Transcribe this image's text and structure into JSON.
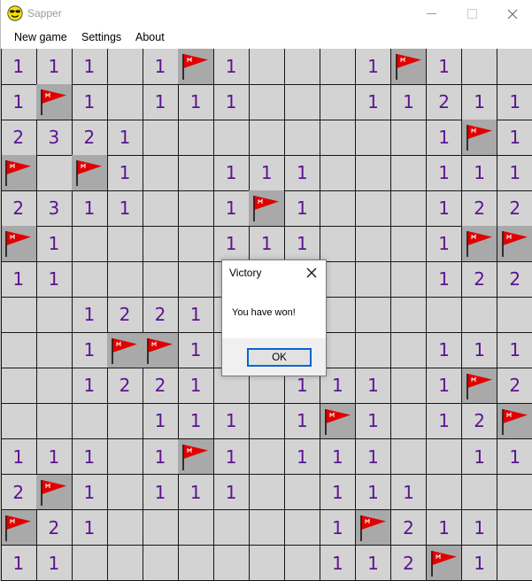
{
  "window": {
    "title": "Sapper",
    "app_icon": "sunglasses-smiley-icon"
  },
  "menu": {
    "items": [
      "New game",
      "Settings",
      "About"
    ]
  },
  "board": {
    "rows": 15,
    "cols": 15,
    "grid": [
      [
        "1",
        "1",
        "1",
        "",
        "1",
        "F",
        "1",
        "",
        "",
        "",
        "1",
        "F",
        "1",
        "",
        ""
      ],
      [
        "1",
        "F",
        "1",
        "",
        "1",
        "1",
        "1",
        "",
        "",
        "",
        "1",
        "1",
        "2",
        "1",
        "1"
      ],
      [
        "2",
        "3",
        "2",
        "1",
        "",
        "",
        "",
        "",
        "",
        "",
        "",
        "",
        "1",
        "F",
        "1"
      ],
      [
        "F",
        "",
        "F",
        "1",
        "",
        "",
        "1",
        "1",
        "1",
        "",
        "",
        "",
        "1",
        "1",
        "1"
      ],
      [
        "2",
        "3",
        "1",
        "1",
        "",
        "",
        "1",
        "F",
        "1",
        "",
        "",
        "",
        "1",
        "2",
        "2"
      ],
      [
        "F",
        "1",
        "",
        "",
        "",
        "",
        "1",
        "1",
        "1",
        "",
        "",
        "",
        "1",
        "F",
        "F"
      ],
      [
        "1",
        "1",
        "",
        "",
        "",
        "",
        "",
        "",
        "",
        "",
        "",
        "",
        "1",
        "2",
        "2"
      ],
      [
        "",
        "",
        "1",
        "2",
        "2",
        "1",
        "",
        "",
        "",
        "",
        "",
        "",
        "",
        "",
        ""
      ],
      [
        "",
        "",
        "1",
        "F",
        "F",
        "1",
        "",
        "",
        "",
        "",
        "",
        "",
        "1",
        "1",
        "1"
      ],
      [
        "",
        "",
        "1",
        "2",
        "2",
        "1",
        "",
        "",
        "1",
        "1",
        "1",
        "",
        "1",
        "F",
        "2"
      ],
      [
        "",
        "",
        "",
        "",
        "1",
        "1",
        "1",
        "",
        "1",
        "F",
        "1",
        "",
        "1",
        "2",
        "F"
      ],
      [
        "1",
        "1",
        "1",
        "",
        "1",
        "F",
        "1",
        "",
        "1",
        "1",
        "1",
        "",
        "",
        "1",
        "1"
      ],
      [
        "2",
        "F",
        "1",
        "",
        "1",
        "1",
        "1",
        "",
        "",
        "1",
        "1",
        "1",
        "",
        "",
        ""
      ],
      [
        "F",
        "2",
        "1",
        "",
        "",
        "",
        "",
        "",
        "",
        "1",
        "F",
        "2",
        "1",
        "1",
        ""
      ],
      [
        "1",
        "1",
        "",
        "",
        "",
        "",
        "",
        "",
        "",
        "1",
        "1",
        "2",
        "F",
        "1",
        ""
      ]
    ]
  },
  "dialog": {
    "title": "Victory",
    "message": "You have won!",
    "ok_label": "OK"
  },
  "colors": {
    "number": "#5c1391",
    "flag": "#e00000",
    "open_cell": "#d3d3d3",
    "flag_cell": "#a9a9a9"
  }
}
